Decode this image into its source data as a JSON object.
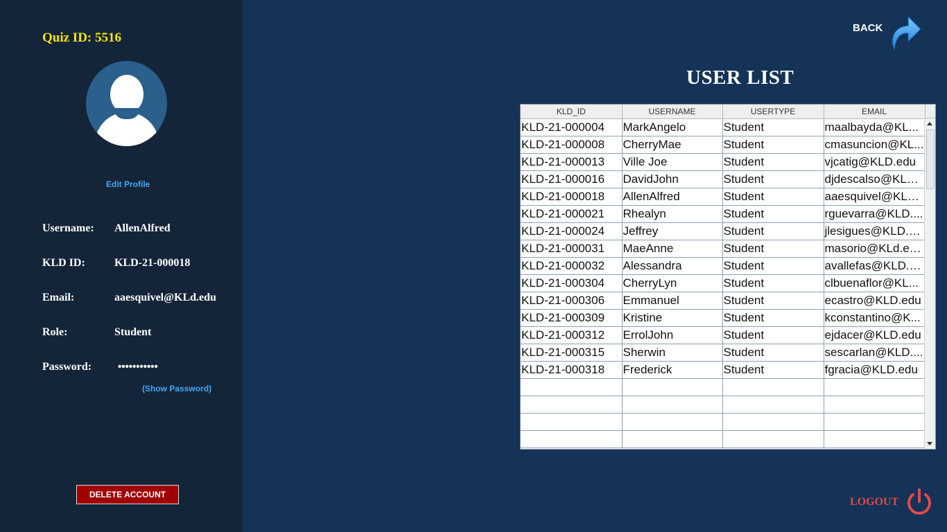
{
  "sidebar": {
    "quiz_id": "Quiz ID: 5516",
    "edit_profile": "Edit Profile",
    "labels": {
      "username": "Username:",
      "kld_id": "KLD ID:",
      "email": "Email:",
      "role": "Role:",
      "password": "Password:"
    },
    "values": {
      "username": "AllenAlfred",
      "kld_id": "KLD-21-000018",
      "email": "aaesquivel@KLd.edu",
      "role": "Student",
      "password": "•••••••••••"
    },
    "show_password": "(Show Password)",
    "delete_account": "DELETE ACCOUNT"
  },
  "header": {
    "back_label": "BACK",
    "title": "USER LIST"
  },
  "table": {
    "columns": [
      "KLD_ID",
      "USERNAME",
      "USERTYPE",
      "EMAIL"
    ],
    "rows": [
      [
        "KLD-21-000004",
        "MarkAngelo",
        "Student",
        "maalbayda@KL..."
      ],
      [
        "KLD-21-000008",
        "CherryMae",
        "Student",
        "cmasuncion@KL..."
      ],
      [
        "KLD-21-000013",
        "Ville Joe",
        "Student",
        "vjcatig@KLD.edu"
      ],
      [
        "KLD-21-000016",
        "DavidJohn",
        "Student",
        "djdescalso@KLD...."
      ],
      [
        "KLD-21-000018",
        "AllenAlfred",
        "Student",
        "aaesquivel@KLd...."
      ],
      [
        "KLD-21-000021",
        "Rhealyn",
        "Student",
        "rguevarra@KLD...."
      ],
      [
        "KLD-21-000024",
        "Jeffrey",
        "Student",
        "jlesigues@KLD.e..."
      ],
      [
        "KLD-21-000031",
        "MaeAnne",
        "Student",
        "masorio@KLd.ed..."
      ],
      [
        "KLD-21-000032",
        "Alessandra",
        "Student",
        "avallefas@KLD.e..."
      ],
      [
        "KLD-21-000304",
        "CherryLyn",
        "Student",
        "clbuenaflor@KL..."
      ],
      [
        "KLD-21-000306",
        "Emmanuel",
        "Student",
        "ecastro@KLD.edu"
      ],
      [
        "KLD-21-000309",
        "Kristine",
        "Student",
        "kconstantino@K..."
      ],
      [
        "KLD-21-000312",
        "ErrolJohn",
        "Student",
        "ejdacer@KLD.edu"
      ],
      [
        "KLD-21-000315",
        "Sherwin",
        "Student",
        "sescarlan@KLD...."
      ],
      [
        "KLD-21-000318",
        "Frederick",
        "Student",
        "fgracia@KLD.edu"
      ],
      [
        "",
        "",
        "",
        ""
      ],
      [
        "",
        "",
        "",
        ""
      ],
      [
        "",
        "",
        "",
        ""
      ],
      [
        "",
        "",
        "",
        ""
      ]
    ]
  },
  "footer": {
    "logout_label": "LOGOUT"
  },
  "icons": {
    "back": "curved-arrow-right-icon",
    "logout": "power-icon",
    "avatar": "user-silhouette-icon"
  },
  "colors": {
    "sidebar_bg": "#14253a",
    "main_bg": "#143356",
    "quiz_id": "#f5e600",
    "link": "#3fa9f5",
    "delete_bg": "#a00000",
    "logout": "#e14a4a"
  }
}
